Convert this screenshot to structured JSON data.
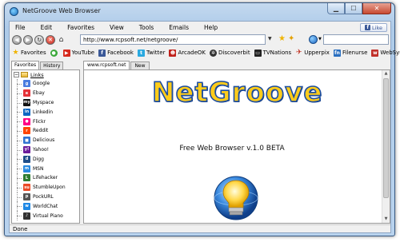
{
  "window": {
    "title": "NetGroove Web Browser"
  },
  "menu": {
    "items": [
      "File",
      "Edit",
      "Favorites",
      "View",
      "Tools",
      "Emails",
      "Help"
    ],
    "like_label": "Like"
  },
  "navigation": {
    "url": "http://www.rcpsoft.net/netgroove/"
  },
  "favorites_bar": {
    "items": [
      {
        "label": "Favorites",
        "icon": "favorites-star-icon",
        "color": "#f0b400"
      },
      {
        "label": "",
        "icon": "green-globe-icon",
        "color": "#3aa83a"
      },
      {
        "label": "YouTube",
        "icon": "youtube-icon",
        "color": "#d62a1e"
      },
      {
        "label": "Facebook",
        "icon": "facebook-icon",
        "color": "#3b5998"
      },
      {
        "label": "Twitter",
        "icon": "twitter-icon",
        "color": "#2aa9e0"
      },
      {
        "label": "ArcadeOK",
        "icon": "arcadeok-icon",
        "color": "#c0201a"
      },
      {
        "label": "Discoverbit",
        "icon": "discoverbit-icon",
        "color": "#333333"
      },
      {
        "label": "TVNations",
        "icon": "tvnations-icon",
        "color": "#222222"
      },
      {
        "label": "Upperpix",
        "icon": "upperpix-icon",
        "color": "#c03020"
      },
      {
        "label": "Filenurse",
        "icon": "filenurse-icon",
        "color": "#2a6fc0"
      },
      {
        "label": "WebSyrup",
        "icon": "websyrup-icon",
        "color": "#c0302a"
      }
    ]
  },
  "sidebar": {
    "tabs": [
      "Favorites",
      "History"
    ],
    "root_label": "Links",
    "links": [
      {
        "label": "Google",
        "icon": "google-icon",
        "color": "#4a7de0",
        "glyph": "g"
      },
      {
        "label": "Ebay",
        "icon": "ebay-icon",
        "color": "#e53238",
        "glyph": "e"
      },
      {
        "label": "Myspace",
        "icon": "myspace-icon",
        "color": "#111111",
        "glyph": "my"
      },
      {
        "label": "Linkedin",
        "icon": "linkedin-icon",
        "color": "#0a66c2",
        "glyph": "in"
      },
      {
        "label": "Flickr",
        "icon": "flickr-icon",
        "color": "#ff0084",
        "glyph": "●"
      },
      {
        "label": "Reddit",
        "icon": "reddit-icon",
        "color": "#ff4500",
        "glyph": "r"
      },
      {
        "label": "Delicious",
        "icon": "delicious-icon",
        "color": "#3274d0",
        "glyph": "■"
      },
      {
        "label": "Yahoo!",
        "icon": "yahoo-icon",
        "color": "#6a1b9a",
        "glyph": "y!"
      },
      {
        "label": "Digg",
        "icon": "digg-icon",
        "color": "#1f4f8a",
        "glyph": "d"
      },
      {
        "label": "MSN",
        "icon": "msn-icon",
        "color": "#2a8ae0",
        "glyph": "m"
      },
      {
        "label": "Lifehacker",
        "icon": "lifehacker-icon",
        "color": "#2e7d32",
        "glyph": "L"
      },
      {
        "label": "StumbleUpon",
        "icon": "stumbleupon-icon",
        "color": "#eb4924",
        "glyph": "su"
      },
      {
        "label": "PockURL",
        "icon": "pockurl-icon",
        "color": "#555555",
        "glyph": "p"
      },
      {
        "label": "WorldChat",
        "icon": "worldchat-icon",
        "color": "#1e88e5",
        "glyph": "w"
      },
      {
        "label": "Virtual Piano",
        "icon": "virtual-piano-icon",
        "color": "#333333",
        "glyph": "♪"
      }
    ]
  },
  "content": {
    "tabs": [
      "www.rcpsoft.net",
      "New"
    ],
    "brand": "NetGroove",
    "tagline": "Free Web Browser v.1.0 BETA"
  },
  "status": {
    "text": "Done"
  }
}
